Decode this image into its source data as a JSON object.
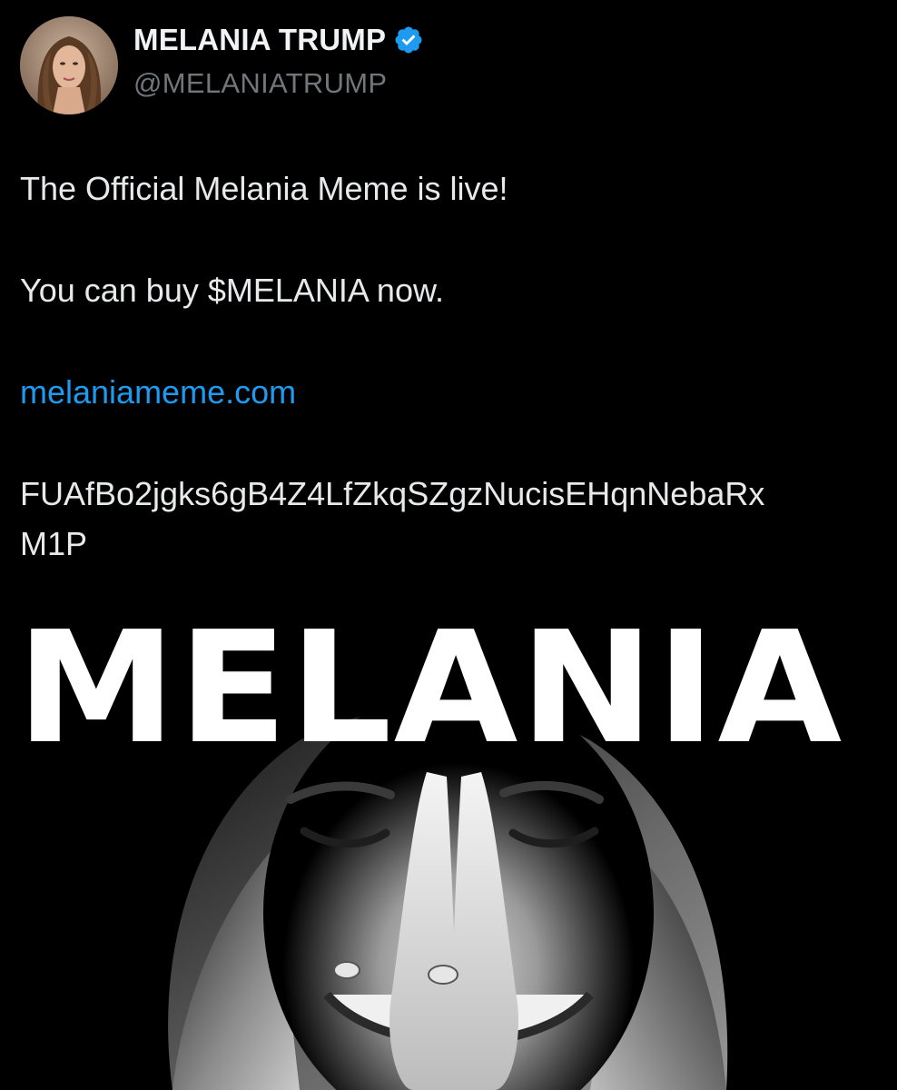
{
  "author": {
    "display_name": "MELANIA TRUMP",
    "handle": "@MELANIATRUMP",
    "verified": true,
    "verified_color": "#1d9bf0"
  },
  "post": {
    "lines": [
      "The Official Melania Meme is live!",
      "You can buy $MELANIA now.",
      "melaniameme.com",
      "FUAfBo2jgks6gB4Z4LfZkqSZgzNucisEHqnNebaRx",
      "M1P"
    ],
    "link_color": "#1d9bf0"
  },
  "media": {
    "title_text": "MELANIA"
  }
}
